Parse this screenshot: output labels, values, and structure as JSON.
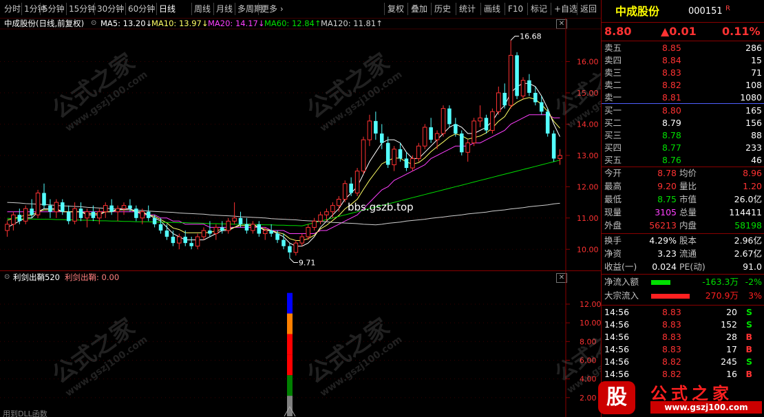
{
  "toolbar": {
    "left": [
      "分时",
      "1分钟",
      "5分钟",
      "15分钟",
      "30分钟",
      "60分钟",
      "日线",
      "周线",
      "月线",
      "多周期",
      "更多 ›"
    ],
    "active_index": 6,
    "right": [
      "复权",
      "叠加",
      "历史",
      "统计",
      "画线",
      "F10",
      "标记",
      "+自选",
      "返回"
    ]
  },
  "chart_header": {
    "title": "中成股份(日线,前复权)",
    "ma5": "MA5: 13.20↓",
    "ma10": "MA10: 13.97↓",
    "ma20": "MA20: 14.17↓",
    "ma60": "MA60: 12.84↑",
    "ma120": "MA120: 11.81↑"
  },
  "colors": {
    "up": "#ff3232",
    "down": "#54ffff",
    "ma5": "#ffffff",
    "ma10": "#ffff66",
    "ma20": "#ff40ff",
    "ma60": "#00e000",
    "ma120": "#cfcfcf"
  },
  "chart_data": {
    "type": "candlestick",
    "y_axis_ticks": [
      "16.00",
      "15.00",
      "14.00",
      "13.00",
      "12.00",
      "11.00",
      "10.00"
    ],
    "ylim": [
      9.5,
      17.0
    ],
    "annotations": {
      "high": "16.68",
      "low": "9.71",
      "watermark_text": "bbs.gszb.top"
    },
    "candles": [
      [
        10.6,
        10.9,
        10.4,
        10.8
      ],
      [
        10.8,
        11.2,
        10.6,
        11.1
      ],
      [
        11.1,
        11.3,
        10.8,
        10.9
      ],
      [
        10.9,
        11.4,
        10.8,
        11.3
      ],
      [
        11.3,
        11.6,
        11.0,
        11.1
      ],
      [
        11.1,
        11.9,
        11.0,
        11.8
      ],
      [
        11.8,
        12.1,
        11.3,
        11.4
      ],
      [
        11.4,
        11.6,
        11.0,
        11.2
      ],
      [
        11.2,
        11.6,
        11.0,
        11.5
      ],
      [
        11.5,
        11.6,
        11.1,
        11.2
      ],
      [
        11.2,
        11.4,
        10.8,
        10.9
      ],
      [
        10.9,
        11.5,
        10.8,
        11.3
      ],
      [
        11.3,
        11.5,
        10.9,
        11.0
      ],
      [
        11.0,
        11.3,
        10.7,
        11.2
      ],
      [
        11.2,
        11.4,
        10.9,
        11.0
      ],
      [
        11.0,
        11.3,
        10.8,
        11.2
      ],
      [
        11.2,
        11.5,
        11.0,
        11.4
      ],
      [
        11.4,
        11.6,
        11.1,
        11.2
      ],
      [
        11.2,
        11.4,
        10.9,
        11.3
      ],
      [
        11.3,
        11.5,
        11.1,
        11.4
      ],
      [
        11.4,
        11.6,
        11.2,
        11.3
      ],
      [
        11.3,
        11.4,
        10.9,
        11.0
      ],
      [
        11.0,
        11.3,
        10.8,
        11.2
      ],
      [
        11.2,
        11.4,
        10.9,
        11.0
      ],
      [
        11.0,
        11.1,
        10.7,
        10.8
      ],
      [
        10.8,
        11.0,
        10.5,
        10.6
      ],
      [
        10.6,
        10.8,
        10.3,
        10.4
      ],
      [
        10.4,
        10.6,
        10.1,
        10.2
      ],
      [
        10.2,
        10.5,
        10.0,
        10.4
      ],
      [
        10.4,
        10.6,
        10.1,
        10.2
      ],
      [
        10.2,
        10.4,
        10.0,
        10.1
      ],
      [
        10.1,
        10.5,
        10.0,
        10.4
      ],
      [
        10.4,
        10.7,
        10.3,
        10.6
      ],
      [
        10.6,
        10.9,
        10.4,
        10.5
      ],
      [
        10.5,
        10.8,
        10.3,
        10.7
      ],
      [
        10.7,
        10.9,
        10.5,
        10.6
      ],
      [
        10.6,
        11.0,
        10.5,
        10.9
      ],
      [
        10.9,
        11.5,
        10.8,
        11.0
      ],
      [
        11.0,
        11.2,
        10.7,
        10.8
      ],
      [
        10.8,
        11.0,
        10.5,
        10.6
      ],
      [
        10.6,
        10.9,
        10.5,
        10.8
      ],
      [
        10.8,
        10.9,
        10.4,
        10.5
      ],
      [
        10.5,
        10.7,
        10.3,
        10.6
      ],
      [
        10.6,
        10.8,
        10.4,
        10.5
      ],
      [
        10.5,
        10.6,
        10.2,
        10.3
      ],
      [
        10.3,
        10.5,
        10.0,
        10.1
      ],
      [
        10.1,
        10.2,
        9.71,
        9.9
      ],
      [
        9.9,
        10.3,
        9.8,
        10.2
      ],
      [
        10.2,
        10.5,
        10.1,
        10.4
      ],
      [
        10.4,
        10.8,
        10.3,
        10.7
      ],
      [
        10.7,
        11.0,
        10.6,
        10.9
      ],
      [
        10.9,
        11.2,
        10.8,
        11.1
      ],
      [
        11.1,
        11.3,
        10.9,
        11.2
      ],
      [
        11.2,
        11.5,
        11.0,
        11.4
      ],
      [
        11.4,
        11.7,
        11.2,
        11.6
      ],
      [
        11.6,
        12.2,
        11.5,
        12.1
      ],
      [
        12.1,
        12.3,
        11.7,
        11.8
      ],
      [
        11.8,
        12.6,
        11.7,
        12.5
      ],
      [
        12.5,
        13.6,
        12.4,
        13.5
      ],
      [
        13.5,
        14.3,
        13.3,
        14.1
      ],
      [
        14.1,
        14.4,
        13.5,
        13.7
      ],
      [
        13.7,
        14.0,
        13.2,
        13.4
      ],
      [
        13.4,
        13.6,
        12.6,
        12.7
      ],
      [
        12.7,
        13.3,
        12.5,
        13.2
      ],
      [
        13.2,
        13.4,
        12.8,
        12.9
      ],
      [
        12.9,
        13.1,
        12.5,
        12.6
      ],
      [
        12.6,
        13.0,
        12.5,
        12.9
      ],
      [
        12.9,
        13.4,
        12.8,
        13.3
      ],
      [
        13.3,
        14.0,
        13.2,
        13.9
      ],
      [
        13.9,
        14.2,
        13.4,
        13.5
      ],
      [
        13.5,
        13.8,
        13.2,
        13.7
      ],
      [
        13.7,
        14.6,
        13.6,
        14.5
      ],
      [
        14.5,
        14.6,
        13.9,
        14.0
      ],
      [
        14.0,
        14.2,
        13.6,
        13.7
      ],
      [
        13.7,
        13.8,
        13.0,
        13.1
      ],
      [
        13.1,
        13.5,
        12.8,
        13.4
      ],
      [
        13.4,
        14.2,
        13.3,
        14.1
      ],
      [
        14.1,
        14.6,
        13.9,
        14.2
      ],
      [
        14.2,
        14.3,
        13.7,
        13.8
      ],
      [
        13.8,
        14.5,
        13.7,
        14.4
      ],
      [
        14.4,
        15.2,
        14.3,
        15.0
      ],
      [
        15.0,
        15.3,
        14.5,
        14.6
      ],
      [
        14.6,
        16.68,
        14.5,
        16.2
      ],
      [
        16.2,
        16.3,
        14.8,
        14.9
      ],
      [
        14.9,
        15.5,
        14.8,
        15.4
      ],
      [
        15.4,
        15.6,
        14.9,
        15.0
      ],
      [
        15.0,
        15.2,
        14.6,
        14.7
      ],
      [
        14.7,
        14.9,
        14.3,
        14.4
      ],
      [
        14.4,
        14.5,
        13.6,
        13.7
      ],
      [
        13.7,
        13.8,
        12.8,
        12.9
      ],
      [
        12.9,
        13.2,
        12.7,
        13.0
      ]
    ],
    "ma_lines": {
      "ma5": [
        10.7,
        10.8,
        10.9,
        11.0,
        11.0,
        11.2,
        11.3,
        11.3,
        11.3,
        11.2,
        11.2,
        11.2,
        11.2,
        11.1,
        11.1,
        11.1,
        11.2,
        11.2,
        11.3,
        11.3,
        11.3,
        11.2,
        11.2,
        11.1,
        11.0,
        10.9,
        10.7,
        10.5,
        10.4,
        10.3,
        10.3,
        10.3,
        10.3,
        10.4,
        10.5,
        10.6,
        10.6,
        10.7,
        10.8,
        10.8,
        10.8,
        10.7,
        10.6,
        10.6,
        10.5,
        10.4,
        10.2,
        10.1,
        10.1,
        10.2,
        10.4,
        10.7,
        10.9,
        11.1,
        11.3,
        11.6,
        11.8,
        12.0,
        12.4,
        12.8,
        13.1,
        13.4,
        13.5,
        13.5,
        13.4,
        13.1,
        12.9,
        12.9,
        13.1,
        13.3,
        13.5,
        13.7,
        13.9,
        14.0,
        13.9,
        13.7,
        13.7,
        13.8,
        13.9,
        14.1,
        14.4,
        14.6,
        15.0,
        15.2,
        15.3,
        15.3,
        15.2,
        14.9,
        14.5,
        14.0,
        13.6
      ],
      "ma20": [
        11.2,
        11.2,
        11.2,
        11.2,
        11.2,
        11.2,
        11.2,
        11.2,
        11.2,
        11.2,
        11.2,
        11.2,
        11.2,
        11.2,
        11.2,
        11.2,
        11.2,
        11.2,
        11.2,
        11.2,
        11.2,
        11.2,
        11.1,
        11.1,
        11.1,
        11.0,
        11.0,
        10.9,
        10.9,
        10.8,
        10.8,
        10.8,
        10.8,
        10.7,
        10.7,
        10.7,
        10.7,
        10.7,
        10.7,
        10.7,
        10.7,
        10.7,
        10.7,
        10.6,
        10.6,
        10.6,
        10.5,
        10.5,
        10.5,
        10.5,
        10.5,
        10.6,
        10.6,
        10.7,
        10.8,
        10.9,
        11.0,
        11.1,
        11.3,
        11.5,
        11.7,
        11.9,
        12.0,
        12.2,
        12.3,
        12.4,
        12.5,
        12.6,
        12.7,
        12.9,
        13.0,
        13.1,
        13.2,
        13.3,
        13.3,
        13.3,
        13.4,
        13.4,
        13.5,
        13.6,
        13.7,
        13.8,
        14.0,
        14.1,
        14.2,
        14.3,
        14.3,
        14.3,
        14.3,
        14.2,
        14.2
      ]
    },
    "indicator": {
      "name": "利剑出鞘520",
      "value_label": "利剑出鞘: 0.00",
      "y_axis_ticks": [
        "12.00",
        "10.00",
        "8.00",
        "6.00",
        "4.00",
        "2.00"
      ],
      "ylim": [
        0,
        14.5
      ],
      "bar_segments": [
        {
          "from": 0,
          "to": 2.2,
          "color": "#808080"
        },
        {
          "from": 2.2,
          "to": 4.4,
          "color": "#008000"
        },
        {
          "from": 4.4,
          "to": 6.6,
          "color": "#ff0000"
        },
        {
          "from": 6.6,
          "to": 8.8,
          "color": "#ff0000"
        },
        {
          "from": 8.8,
          "to": 11.0,
          "color": "#ff8000"
        },
        {
          "from": 11.0,
          "to": 13.2,
          "color": "#0000ff"
        }
      ]
    }
  },
  "footer": "用到DLL函数",
  "quote": {
    "name": "中成股份",
    "code": "000151",
    "tag": "R",
    "price": "8.80",
    "change": "▲0.01",
    "pct": "0.11%",
    "asks": [
      {
        "label": "卖五",
        "price": "8.85",
        "vol": "286"
      },
      {
        "label": "卖四",
        "price": "8.84",
        "vol": "15"
      },
      {
        "label": "卖三",
        "price": "8.83",
        "vol": "71"
      },
      {
        "label": "卖二",
        "price": "8.82",
        "vol": "108"
      },
      {
        "label": "卖一",
        "price": "8.81",
        "vol": "1080"
      }
    ],
    "bids": [
      {
        "label": "买一",
        "price": "8.80",
        "vol": "165"
      },
      {
        "label": "买二",
        "price": "8.79",
        "vol": "156"
      },
      {
        "label": "买三",
        "price": "8.78",
        "vol": "88"
      },
      {
        "label": "买四",
        "price": "8.77",
        "vol": "233"
      },
      {
        "label": "买五",
        "price": "8.76",
        "vol": "46"
      }
    ],
    "stats": [
      {
        "l1": "今开",
        "v1": "8.78",
        "c1": "#ff3232",
        "l2": "均价",
        "v2": "8.96",
        "c2": "#ff3232"
      },
      {
        "l1": "最高",
        "v1": "9.20",
        "c1": "#ff3232",
        "l2": "量比",
        "v2": "1.20",
        "c2": "#ff3232"
      },
      {
        "l1": "最低",
        "v1": "8.75",
        "c1": "#00e000",
        "l2": "市值",
        "v2": "26.0亿",
        "c2": "#ffffff"
      },
      {
        "l1": "现量",
        "v1": "3105",
        "c1": "#ff40ff",
        "l2": "总量",
        "v2": "114411",
        "c2": "#ffffff"
      },
      {
        "l1": "外盘",
        "v1": "56213",
        "c1": "#ff3232",
        "l2": "内盘",
        "v2": "58198",
        "c2": "#00e000"
      }
    ],
    "stats2": [
      {
        "l1": "换手",
        "v1": "4.29%",
        "l2": "股本",
        "v2": "2.96亿"
      },
      {
        "l1": "净资",
        "v1": "3.23",
        "l2": "流通",
        "v2": "2.67亿"
      },
      {
        "l1": "收益(一)",
        "v1": "0.024",
        "l2": "PE(动)",
        "v2": "91.0"
      }
    ],
    "flow": [
      {
        "label": "净流入额",
        "value": "-163.3万",
        "pct": "-2%",
        "color": "#00e000",
        "bar": 0.5
      },
      {
        "label": "大宗流入",
        "value": "270.9万",
        "pct": "3%",
        "color": "#ff2020",
        "bar": 1.0
      }
    ],
    "ticks": [
      {
        "time": "14:56",
        "price": "8.83",
        "vol": "20",
        "side": "S"
      },
      {
        "time": "14:56",
        "price": "8.83",
        "vol": "152",
        "side": "S"
      },
      {
        "time": "14:56",
        "price": "8.83",
        "vol": "28",
        "side": "B"
      },
      {
        "time": "14:56",
        "price": "8.83",
        "vol": "17",
        "side": "B"
      },
      {
        "time": "14:56",
        "price": "8.82",
        "vol": "245",
        "side": "S"
      },
      {
        "time": "14:56",
        "price": "8.82",
        "vol": "16",
        "side": "B"
      }
    ]
  },
  "watermark": {
    "title": "公式之家",
    "url": "www.gszj100.com"
  },
  "logo": {
    "icon_char": "股",
    "title": "公式之家",
    "url": "www.gszj100.com"
  }
}
